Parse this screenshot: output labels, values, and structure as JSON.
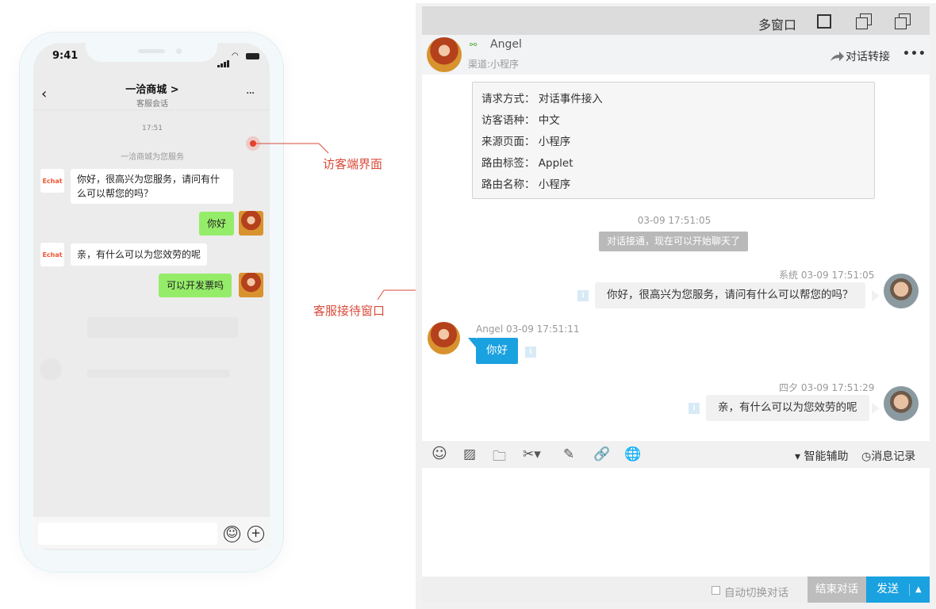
{
  "phone": {
    "status_time": "9:41",
    "title": "一洽商城 >",
    "subtitle": "客服会话",
    "back_icon": "‹",
    "more_icon": "···",
    "time_label": "17:51",
    "system_notice": "一洽商城为您服务",
    "logo_text": "Echat",
    "messages": [
      {
        "side": "left",
        "text": "你好，很高兴为您服务，请问有什么可以帮您的吗？"
      },
      {
        "side": "right",
        "text": "你好"
      },
      {
        "side": "left",
        "text": "亲，有什么可以为您效劳的呢"
      },
      {
        "side": "right",
        "text": "可以开发票吗"
      }
    ],
    "emoji_icon": "☺",
    "plus_icon": "+"
  },
  "annotations": {
    "visitor": "访客端界面",
    "agent": "客服接待窗口"
  },
  "window": {
    "multi_window_label": "多窗口",
    "visitor_name": "Angel",
    "link_icon": "⚯",
    "channel": "渠道:小程序",
    "transfer_label": "对话转接",
    "more_icon": "•••",
    "info_rows": [
      "请求方式： 对话事件接入",
      "访客语种： 中文",
      "来源页面： 小程序",
      "路由标签： Applet",
      "路由名称： 小程序"
    ],
    "connect_time": "03-09 17:51:05",
    "connect_notice": "对话接通，现在可以开始聊天了",
    "messages": [
      {
        "from": "agent",
        "meta": "系统  03-09 17:51:05",
        "text": "你好，很高兴为您服务，请问有什么可以帮您的吗？"
      },
      {
        "from": "visitor",
        "meta": "Angel  03-09 17:51:11",
        "text": "你好"
      },
      {
        "from": "agent",
        "meta": "四夕  03-09 17:51:29",
        "text": "亲，有什么可以为您效劳的呢"
      }
    ],
    "indicator_icon": "ℹ",
    "toolbar_icons": {
      "emoji": "☺",
      "image": "▨",
      "folder": "🗀",
      "scissors": "✂▾",
      "edit": "✎",
      "link": "🔗",
      "globe": "🌐"
    },
    "smart_assist": "▾ 智能辅助",
    "history": "◷消息记录",
    "auto_switch": "自动切换对话",
    "end_button": "结束对话",
    "send_button": "发送",
    "send_arrow": "▲"
  },
  "colors": {
    "accent": "#1aa1e0",
    "wechat_green": "#95ec69",
    "annotation_red": "#d94a3a"
  }
}
